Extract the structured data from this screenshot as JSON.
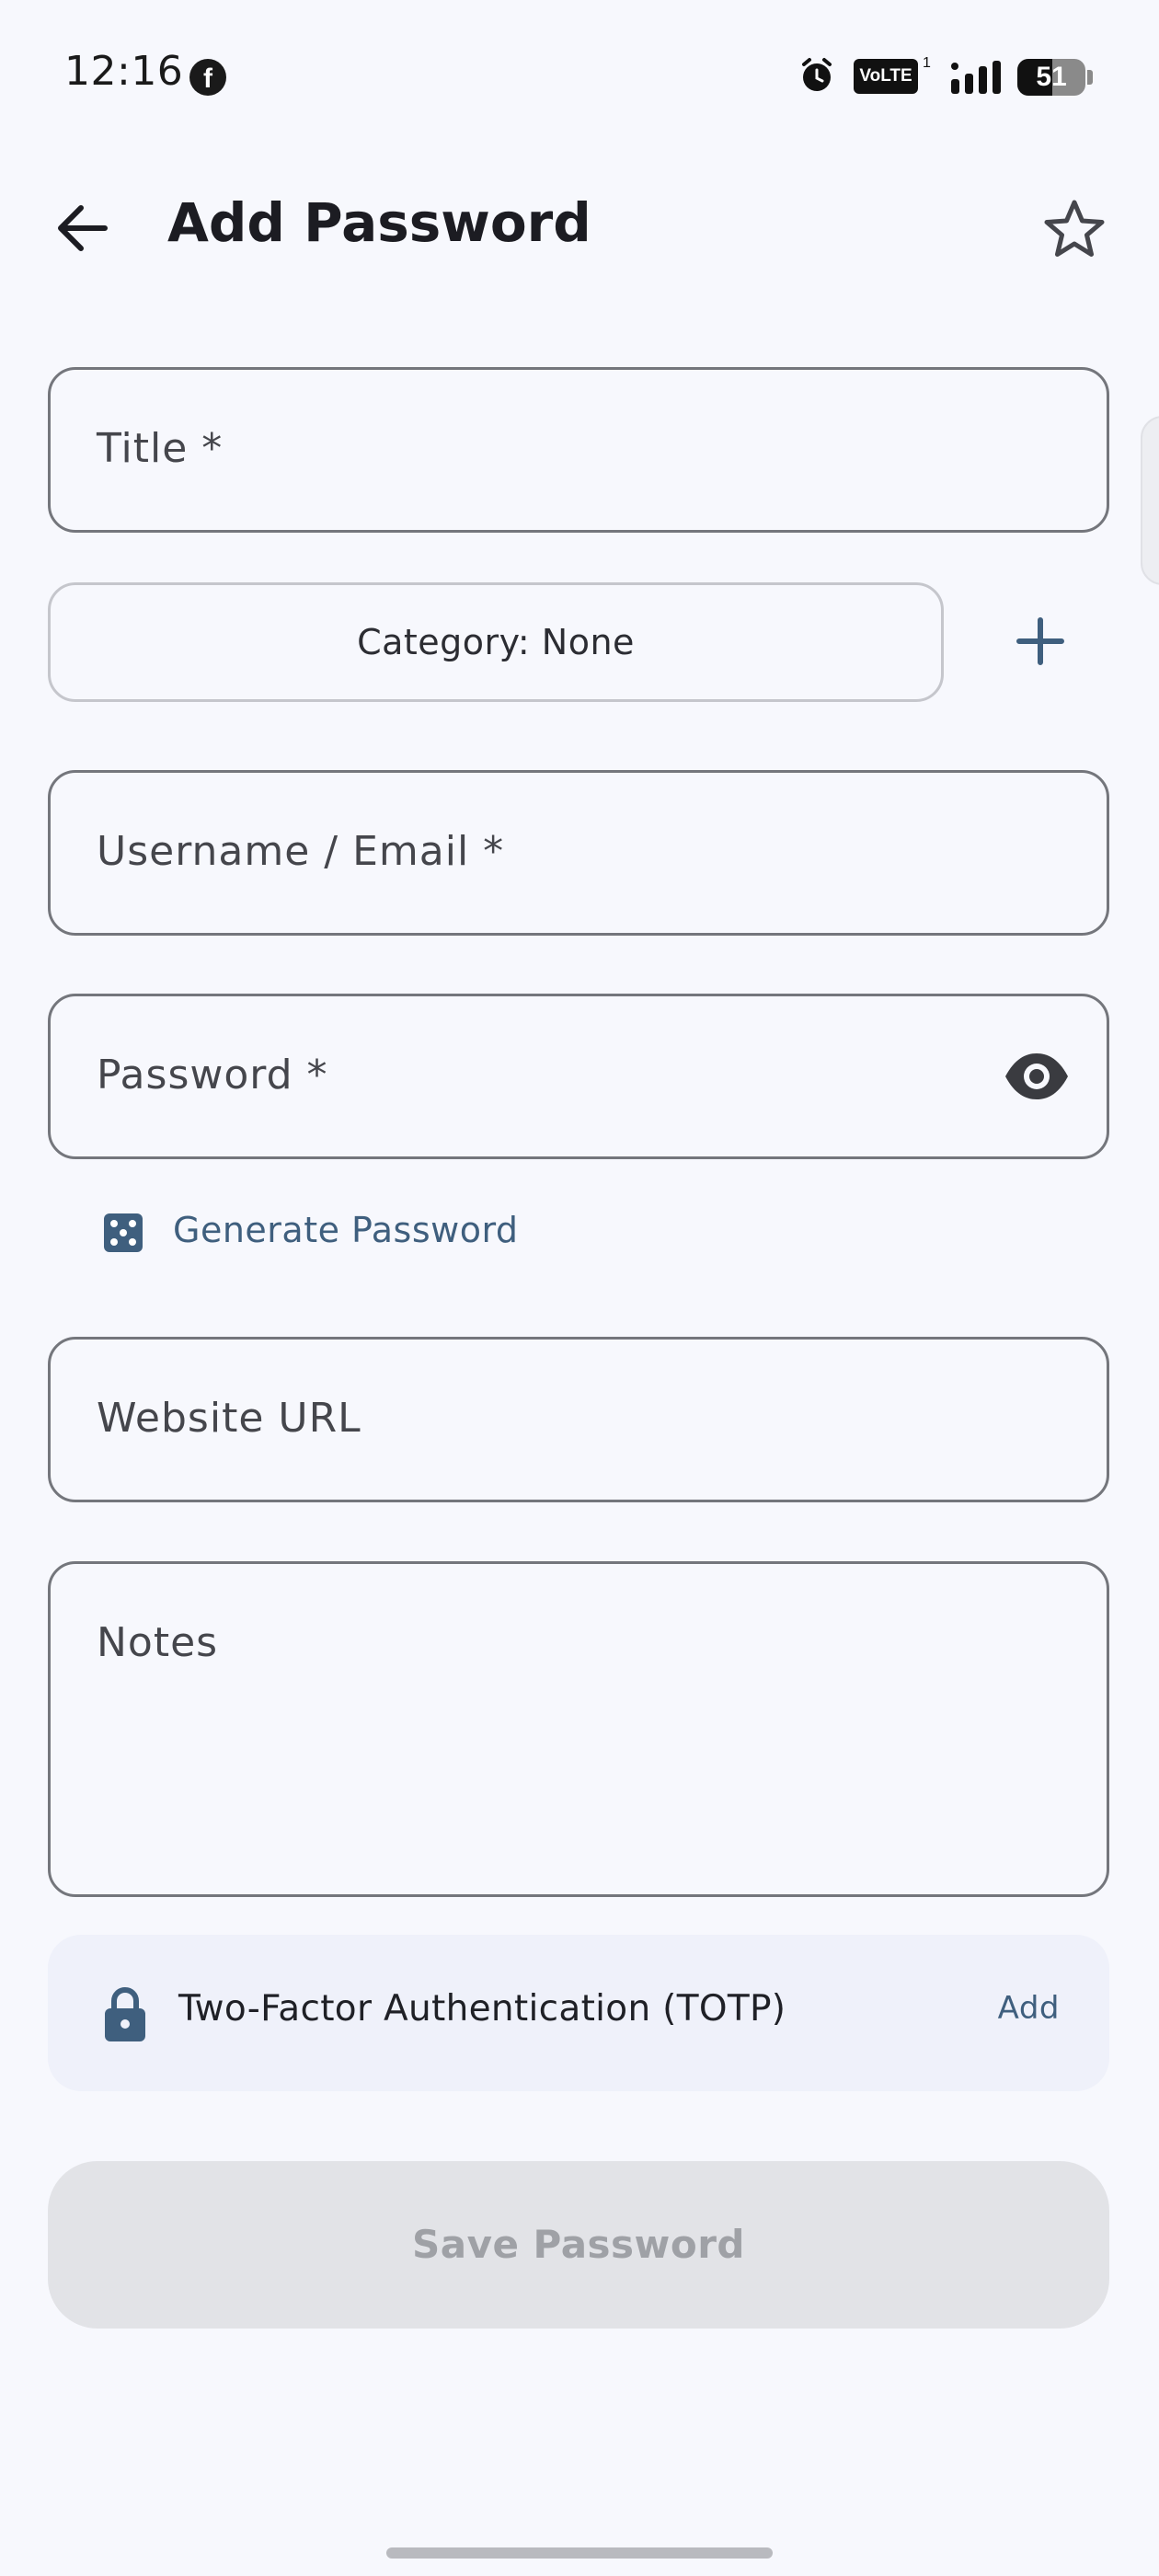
{
  "status_bar": {
    "time": "12:16",
    "facebook_glyph": "f",
    "volte": "VoLTE",
    "volte_sim": "1",
    "battery": "51",
    "battery_level": 0.51
  },
  "app_bar": {
    "title": "Add Password",
    "back_icon": "arrow-left-icon",
    "favorite_icon": "star-outline-icon"
  },
  "form": {
    "title_placeholder": "Title *",
    "category_label": "Category: None",
    "username_placeholder": "Username / Email *",
    "password_placeholder": "Password *",
    "generate_password_label": "Generate Password",
    "website_placeholder": "Website URL",
    "notes_placeholder": "Notes",
    "totp_label": "Two-Factor Authentication (TOTP)",
    "totp_add_label": "Add",
    "save_label": "Save Password"
  },
  "colors": {
    "background": "#f7f8fd",
    "accent": "#3f5f7e",
    "field_border": "#74767c",
    "disabled_button": "#e2e3e7"
  }
}
